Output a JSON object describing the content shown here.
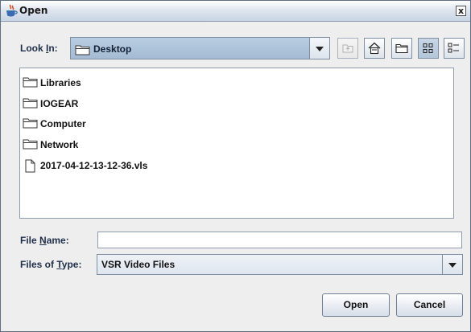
{
  "window": {
    "title": "Open",
    "close_glyph": "x"
  },
  "lookin": {
    "label_prefix": "Look ",
    "label_mnemonic": "I",
    "label_suffix": "n:",
    "value": "Desktop"
  },
  "toolbar": {
    "icons": [
      "up-one-level-icon",
      "home-icon",
      "new-folder-icon",
      "list-view-icon",
      "details-view-icon"
    ]
  },
  "files": [
    {
      "name": "Libraries",
      "type": "folder"
    },
    {
      "name": "IOGEAR",
      "type": "folder"
    },
    {
      "name": "Computer",
      "type": "folder"
    },
    {
      "name": "Network",
      "type": "folder"
    },
    {
      "name": "2017-04-12-13-12-36.vls",
      "type": "file"
    }
  ],
  "filename": {
    "label_prefix": "File ",
    "label_mnemonic": "N",
    "label_suffix": "ame:",
    "value": ""
  },
  "filetype": {
    "label_prefix": "Files of ",
    "label_mnemonic": "T",
    "label_suffix": "ype:",
    "value": "VSR Video Files"
  },
  "buttons": {
    "open": "Open",
    "cancel": "Cancel"
  },
  "colors": {
    "titlebar": "#c9d5e4",
    "combo_selected": "#a4bbd3",
    "border": "#7d8da3"
  }
}
